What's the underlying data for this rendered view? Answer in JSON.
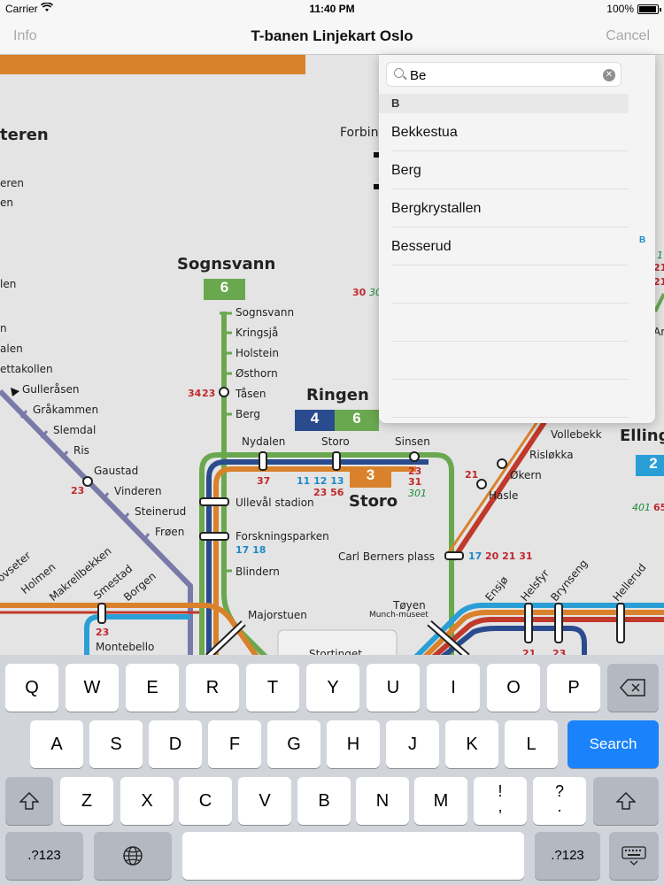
{
  "status_bar": {
    "carrier": "Carrier",
    "time": "11:40 PM",
    "battery": "100%"
  },
  "nav": {
    "left_button": "Info",
    "title": "T-banen Linjekart Oslo",
    "right_button": "Cancel"
  },
  "search": {
    "query": "Be",
    "section_header": "B",
    "results": [
      "Bekkestua",
      "Berg",
      "Bergkrystallen",
      "Besserud"
    ],
    "index_letter": "B"
  },
  "map": {
    "lines": {
      "green": "#6aa84f",
      "blue": "#2a4b8d",
      "orange": "#d9822b",
      "purple": "#7a7aa8",
      "lightblue": "#2a9fd6",
      "red": "#c0392b"
    },
    "labels": {
      "sognsvann_title": "Sognsvann",
      "ringen_title": "Ringen",
      "storo_title": "Storo",
      "ellin": "Elling",
      "teren": "teren",
      "forbin": "Forbin",
      "sognsvann": "Sognsvann",
      "kringsja": "Kringsjå",
      "holstein": "Holstein",
      "osthorn": "Østhorn",
      "tasen": "Tåsen",
      "berg": "Berg",
      "nydalen": "Nydalen",
      "storo_st": "Storo",
      "sinsen": "Sinsen",
      "ulleval": "Ullevål stadion",
      "forskningsparken": "Forskningsparken",
      "blindern": "Blindern",
      "majorstuen": "Majorstuen",
      "carl_berners": "Carl Berners plass",
      "toyen": "Tøyen",
      "munch": "Munch-museet",
      "stortinget": "Stortinget",
      "vollebekk": "Vollebekk",
      "rislokka": "Risløkka",
      "okern": "Økern",
      "hasle": "Hasle",
      "gulleraasen": "Gulleråsen",
      "grakammen": "Gråkammen",
      "slemdal": "Slemdal",
      "ris": "Ris",
      "gaustad": "Gaustad",
      "vinderen": "Vinderen",
      "steinerud": "Steinerud",
      "froen": "Frøen",
      "ettakollen": "ettakollen",
      "eren": "eren",
      "en": "en",
      "len": "len",
      "n": "n",
      "alen": "alen",
      "montebello": "Montebello",
      "hovseter": "Hovseter",
      "holmen": "Holmen",
      "makrellbekken": "Makrellbekken",
      "smestad": "Smestad",
      "borgen": "Borgen",
      "ensjo": "Ensjø",
      "helsfyr": "Helsfyr",
      "brynseng": "Brynseng",
      "hellerud": "Hellerud",
      "ar": "Ar"
    },
    "badges": {
      "sognsvann_line": "6",
      "ringen_a": "4",
      "ringen_b": "6",
      "storo_line": "3",
      "elling_line": "2"
    },
    "bus_numbers": {
      "tasen": "34",
      "tasen_b": "23",
      "nydalen": "37",
      "storo_blue": "11 12 13",
      "storo_red": "23 56",
      "sinsen_a": "23",
      "sinsen_b": "31",
      "sinsen_c": "301",
      "forskning": "17 18",
      "carl_blue": "17",
      "carl_red": "20 21 31",
      "hasle": "21",
      "gaustad": "23",
      "montebello": "23",
      "helsfyr": "21",
      "brynseng": "23",
      "forbin_a": "30",
      "forbin_b": "30",
      "elling_a": "401",
      "elling_b": "65",
      "right_a": "1",
      "right_b": "21",
      "right_c": "21"
    }
  },
  "keyboard": {
    "row1": [
      "Q",
      "W",
      "E",
      "R",
      "T",
      "Y",
      "U",
      "I",
      "O",
      "P"
    ],
    "row2": [
      "A",
      "S",
      "D",
      "F",
      "G",
      "H",
      "J",
      "K",
      "L"
    ],
    "row3": [
      "Z",
      "X",
      "C",
      "V",
      "B",
      "N",
      "M"
    ],
    "exclaim": "!",
    "comma": ",",
    "question": "?",
    "period": ".",
    "search_key": "Search",
    "numbers_key": ".?123"
  }
}
